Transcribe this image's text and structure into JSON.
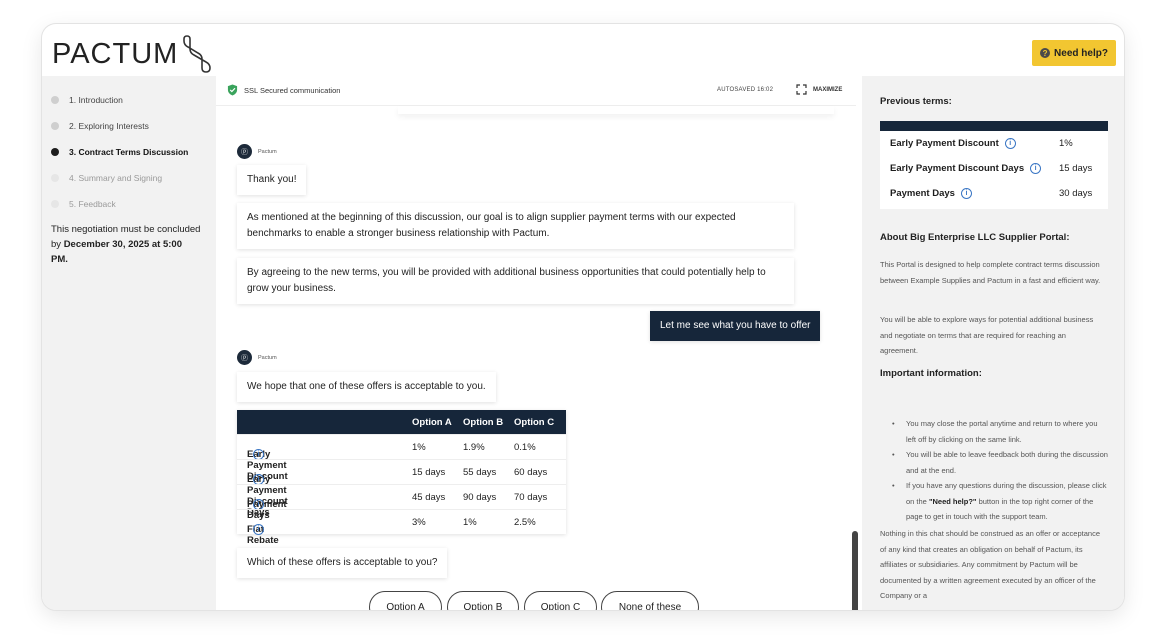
{
  "header": {
    "logo_text": "PACTUM",
    "help_label": "Need help?"
  },
  "steps": [
    {
      "label": "1. Introduction"
    },
    {
      "label": "2. Exploring Interests"
    },
    {
      "label": "3. Contract Terms Discussion"
    },
    {
      "label": "4. Summary and Signing"
    },
    {
      "label": "5. Feedback"
    }
  ],
  "deadline": {
    "prefix": "This negotiation must be concluded by",
    "date": "December 30, 2025 at 5:00 PM."
  },
  "topbar": {
    "ssl": "SSL Secured communication",
    "autosave": "AUTOSAVED 16:02",
    "maximize": "MAXIMIZE"
  },
  "chat": {
    "author": "Pactum",
    "messages": [
      "Thank you!",
      "As mentioned at the beginning of this discussion, our goal is to align supplier payment terms with our expected benchmarks to enable a stronger business relationship with Pactum.",
      "By agreeing to the new terms, you will be provided with additional business opportunities that could potentially help to grow your business.",
      "Let me see what you have to offer",
      "We hope that one of these offers is acceptable to you.",
      "Which of these offers is acceptable to you?"
    ]
  },
  "offers": {
    "headers": [
      "Option A",
      "Option B",
      "Option C"
    ],
    "rows": [
      {
        "label": "Early Payment Discount",
        "a": "1%",
        "b": "1.9%",
        "c": "0.1%"
      },
      {
        "label": "Early Payment Discount Days",
        "a": "15 days",
        "b": "55 days",
        "c": "60 days"
      },
      {
        "label": "Payment Days",
        "a": "45 days",
        "b": "90 days",
        "c": "70 days"
      },
      {
        "label": "Flat Rebate",
        "a": "3%",
        "b": "1%",
        "c": "2.5%"
      }
    ]
  },
  "choices": [
    "Option A",
    "Option B",
    "Option C",
    "None of these"
  ],
  "right": {
    "previous_title": "Previous terms:",
    "previous": [
      {
        "label": "Early Payment Discount",
        "value": "1%"
      },
      {
        "label": "Early Payment Discount Days",
        "value": "15 days"
      },
      {
        "label": "Payment Days",
        "value": "30 days"
      }
    ],
    "about_title": "About Big Enterprise LLC Supplier Portal:",
    "about_p1": "This Portal is designed to help complete contract terms discussion between Example Supplies and Pactum in a fast and efficient way.",
    "about_p2": "You will be able to explore ways for potential additional business and negotiate on terms that are required for reaching an agreement.",
    "important_title": "Important information:",
    "bullet1": "You may close the portal anytime and return to where you left off by clicking on the same link.",
    "bullet2": "You will be able to leave feedback both during the discussion and at the end.",
    "bullet3_pre": "If you have any questions during the discussion, please click on the",
    "bullet3_bold": "\"Need help?\"",
    "bullet3_post": "button in the top right corner of the page to get in touch with the support team.",
    "disclaimer": "Nothing in this chat should be construed as an offer or acceptance of any kind that creates an obligation on behalf of Pactum, its affiliates or subsidiaries. Any commitment by Pactum will be documented by a written agreement executed by an officer of the Company or a"
  }
}
